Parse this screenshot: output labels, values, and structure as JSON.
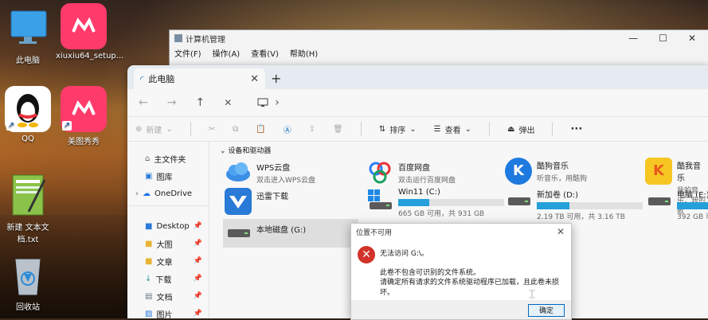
{
  "desktop": {
    "icons": [
      {
        "label": "此电脑",
        "icon": "monitor-icon"
      },
      {
        "label": "xiuxiu64_setup...",
        "icon": "meitu-icon"
      },
      {
        "label": "QQ",
        "icon": "qq-penguin-icon"
      },
      {
        "label": "美图秀秀",
        "icon": "meitu-icon"
      },
      {
        "label": "新建 文本文档.txt",
        "icon": "notepad-icon"
      },
      {
        "label": "回收站",
        "icon": "recycle-bin-icon"
      }
    ]
  },
  "mgmt_window": {
    "title": "计算机管理",
    "menu": [
      "文件(F)",
      "操作(A)",
      "查看(V)",
      "帮助(H)"
    ],
    "controls": [
      "—",
      "☐",
      "✕"
    ]
  },
  "explorer": {
    "tab_title": "此电脑",
    "tab_close": "✕",
    "new_tab": "+",
    "nav": {
      "back": "←",
      "forward": "→",
      "up": "↑",
      "refresh": "✕",
      "chevron": "›"
    },
    "toolbar": {
      "new": "新建",
      "sort": "排序",
      "view": "查看",
      "eject": "弹出",
      "more": "···"
    },
    "sidebar": {
      "items": [
        {
          "label": "主文件夹",
          "icon": "home-icon"
        },
        {
          "label": "图库",
          "icon": "gallery-icon"
        },
        {
          "label": "OneDrive",
          "icon": "cloud-icon"
        },
        {
          "label": "Desktop",
          "icon": "desktop-icon"
        },
        {
          "label": "大图",
          "icon": "folder-icon"
        },
        {
          "label": "文章",
          "icon": "folder-icon"
        },
        {
          "label": "下载",
          "icon": "download-icon"
        },
        {
          "label": "文档",
          "icon": "document-icon"
        },
        {
          "label": "图片",
          "icon": "image-icon"
        }
      ]
    },
    "section_label": "设备和驱动器",
    "apps": [
      {
        "name": "WPS云盘",
        "desc": "双击进入WPS云盘"
      },
      {
        "name": "百度网盘",
        "desc": "双击运行百度网盘"
      },
      {
        "name": "酷狗音乐",
        "desc": "听音乐，用酷狗"
      },
      {
        "name": "酷我音乐",
        "desc": "我的音乐，我的歌"
      },
      {
        "name": "迅雷下载",
        "desc": ""
      }
    ],
    "drives": [
      {
        "name": "Win11 (C:)",
        "info": "665 GB 可用，共 931 GB",
        "used_fraction": 0.29
      },
      {
        "name": "新加卷 (D:)",
        "info": "2.19 TB 可用，共 3.16 TB",
        "used_fraction": 0.31
      },
      {
        "name": "电脑 (E:)",
        "info": "392 GB 可",
        "used_fraction": 0.3
      },
      {
        "name": "本地磁盘 (G:)",
        "info": ""
      }
    ]
  },
  "dialog": {
    "title": "位置不可用",
    "heading": "无法访问 G:\\。",
    "line1": "此卷不包含可识别的文件系统。",
    "line2": "请确定所有请求的文件系统驱动程序已加载，且此卷未损坏。",
    "ok": "确定"
  },
  "colors": {
    "accent": "#26a0da",
    "error": "#d1332a",
    "qq_red": "#e8313a",
    "meitu": "#ff3b6b"
  }
}
